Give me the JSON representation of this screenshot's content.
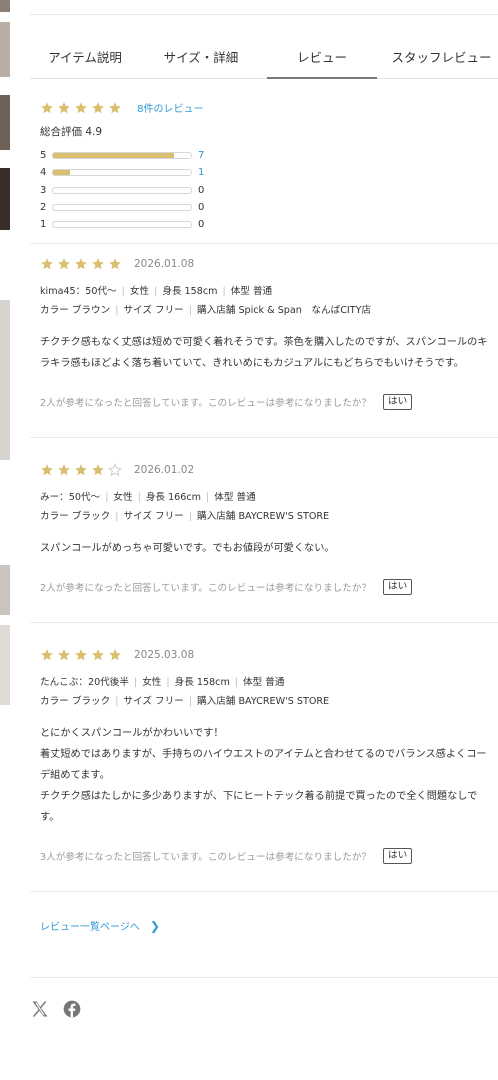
{
  "colors": {
    "star_fill": "#d9bf6f",
    "star_empty": "#c9c9c9",
    "link": "#2e9ad6"
  },
  "tabs": [
    {
      "label": "アイテム説明",
      "active": false
    },
    {
      "label": "サイズ・詳細",
      "active": false
    },
    {
      "label": "レビュー",
      "active": true
    },
    {
      "label": "スタッフレビュー",
      "active": false
    }
  ],
  "summary": {
    "rating_stars": 5,
    "review_count_link": "8件のレビュー",
    "overall_label": "総合評価 4.9",
    "distribution": [
      {
        "level": "5",
        "count": "7",
        "share": 0.875
      },
      {
        "level": "4",
        "count": "1",
        "share": 0.125
      },
      {
        "level": "3",
        "count": "0",
        "share": 0
      },
      {
        "level": "2",
        "count": "0",
        "share": 0
      },
      {
        "level": "1",
        "count": "0",
        "share": 0
      }
    ]
  },
  "reviews": [
    {
      "stars": 5,
      "date": "2026.01.08",
      "user": "kima45：50代〜",
      "gender": "女性",
      "height": "身長 158cm",
      "body_type": "体型 普通",
      "color": "カラー ブラウン",
      "size": "サイズ フリー",
      "store": "購入店舗 Spick & Span　なんばCITY店",
      "text": [
        "チクチク感もなく丈感は短めで可愛く着れそうです。茶色を購入したのですが、スパンコールのキラキラ感もほどよく落ち着いていて、きれいめにもカジュアルにもどちらでもいけそうです。"
      ],
      "helpful": "2人が参考になったと回答しています。このレビューは参考になりましたか？",
      "yes_label": "はい"
    },
    {
      "stars": 4,
      "date": "2026.01.02",
      "user": "みー：50代〜",
      "gender": "女性",
      "height": "身長 166cm",
      "body_type": "体型 普通",
      "color": "カラー ブラック",
      "size": "サイズ フリー",
      "store": "購入店舗 BAYCREW'S STORE",
      "text": [
        "スパンコールがめっちゃ可愛いです。でもお値段が可愛くない。"
      ],
      "helpful": "2人が参考になったと回答しています。このレビューは参考になりましたか？",
      "yes_label": "はい"
    },
    {
      "stars": 5,
      "date": "2025.03.08",
      "user": "たんこぶ：20代後半",
      "gender": "女性",
      "height": "身長 158cm",
      "body_type": "体型 普通",
      "color": "カラー ブラック",
      "size": "サイズ フリー",
      "store": "購入店舗 BAYCREW'S STORE",
      "text": [
        "とにかくスパンコールがかわいいです！",
        "着丈短めではありますが、手持ちのハイウエストのアイテムと合わせてるのでバランス感よくコーデ組めてます。",
        "チクチク感はたしかに多少ありますが、下にヒートテック着る前提で買ったので全く問題なしです。"
      ],
      "helpful": "3人が参考になったと回答しています。このレビューは参考になりましたか？",
      "yes_label": "はい"
    }
  ],
  "more_link": "レビュー一覧ページへ",
  "social": [
    "x-icon",
    "facebook-icon"
  ]
}
